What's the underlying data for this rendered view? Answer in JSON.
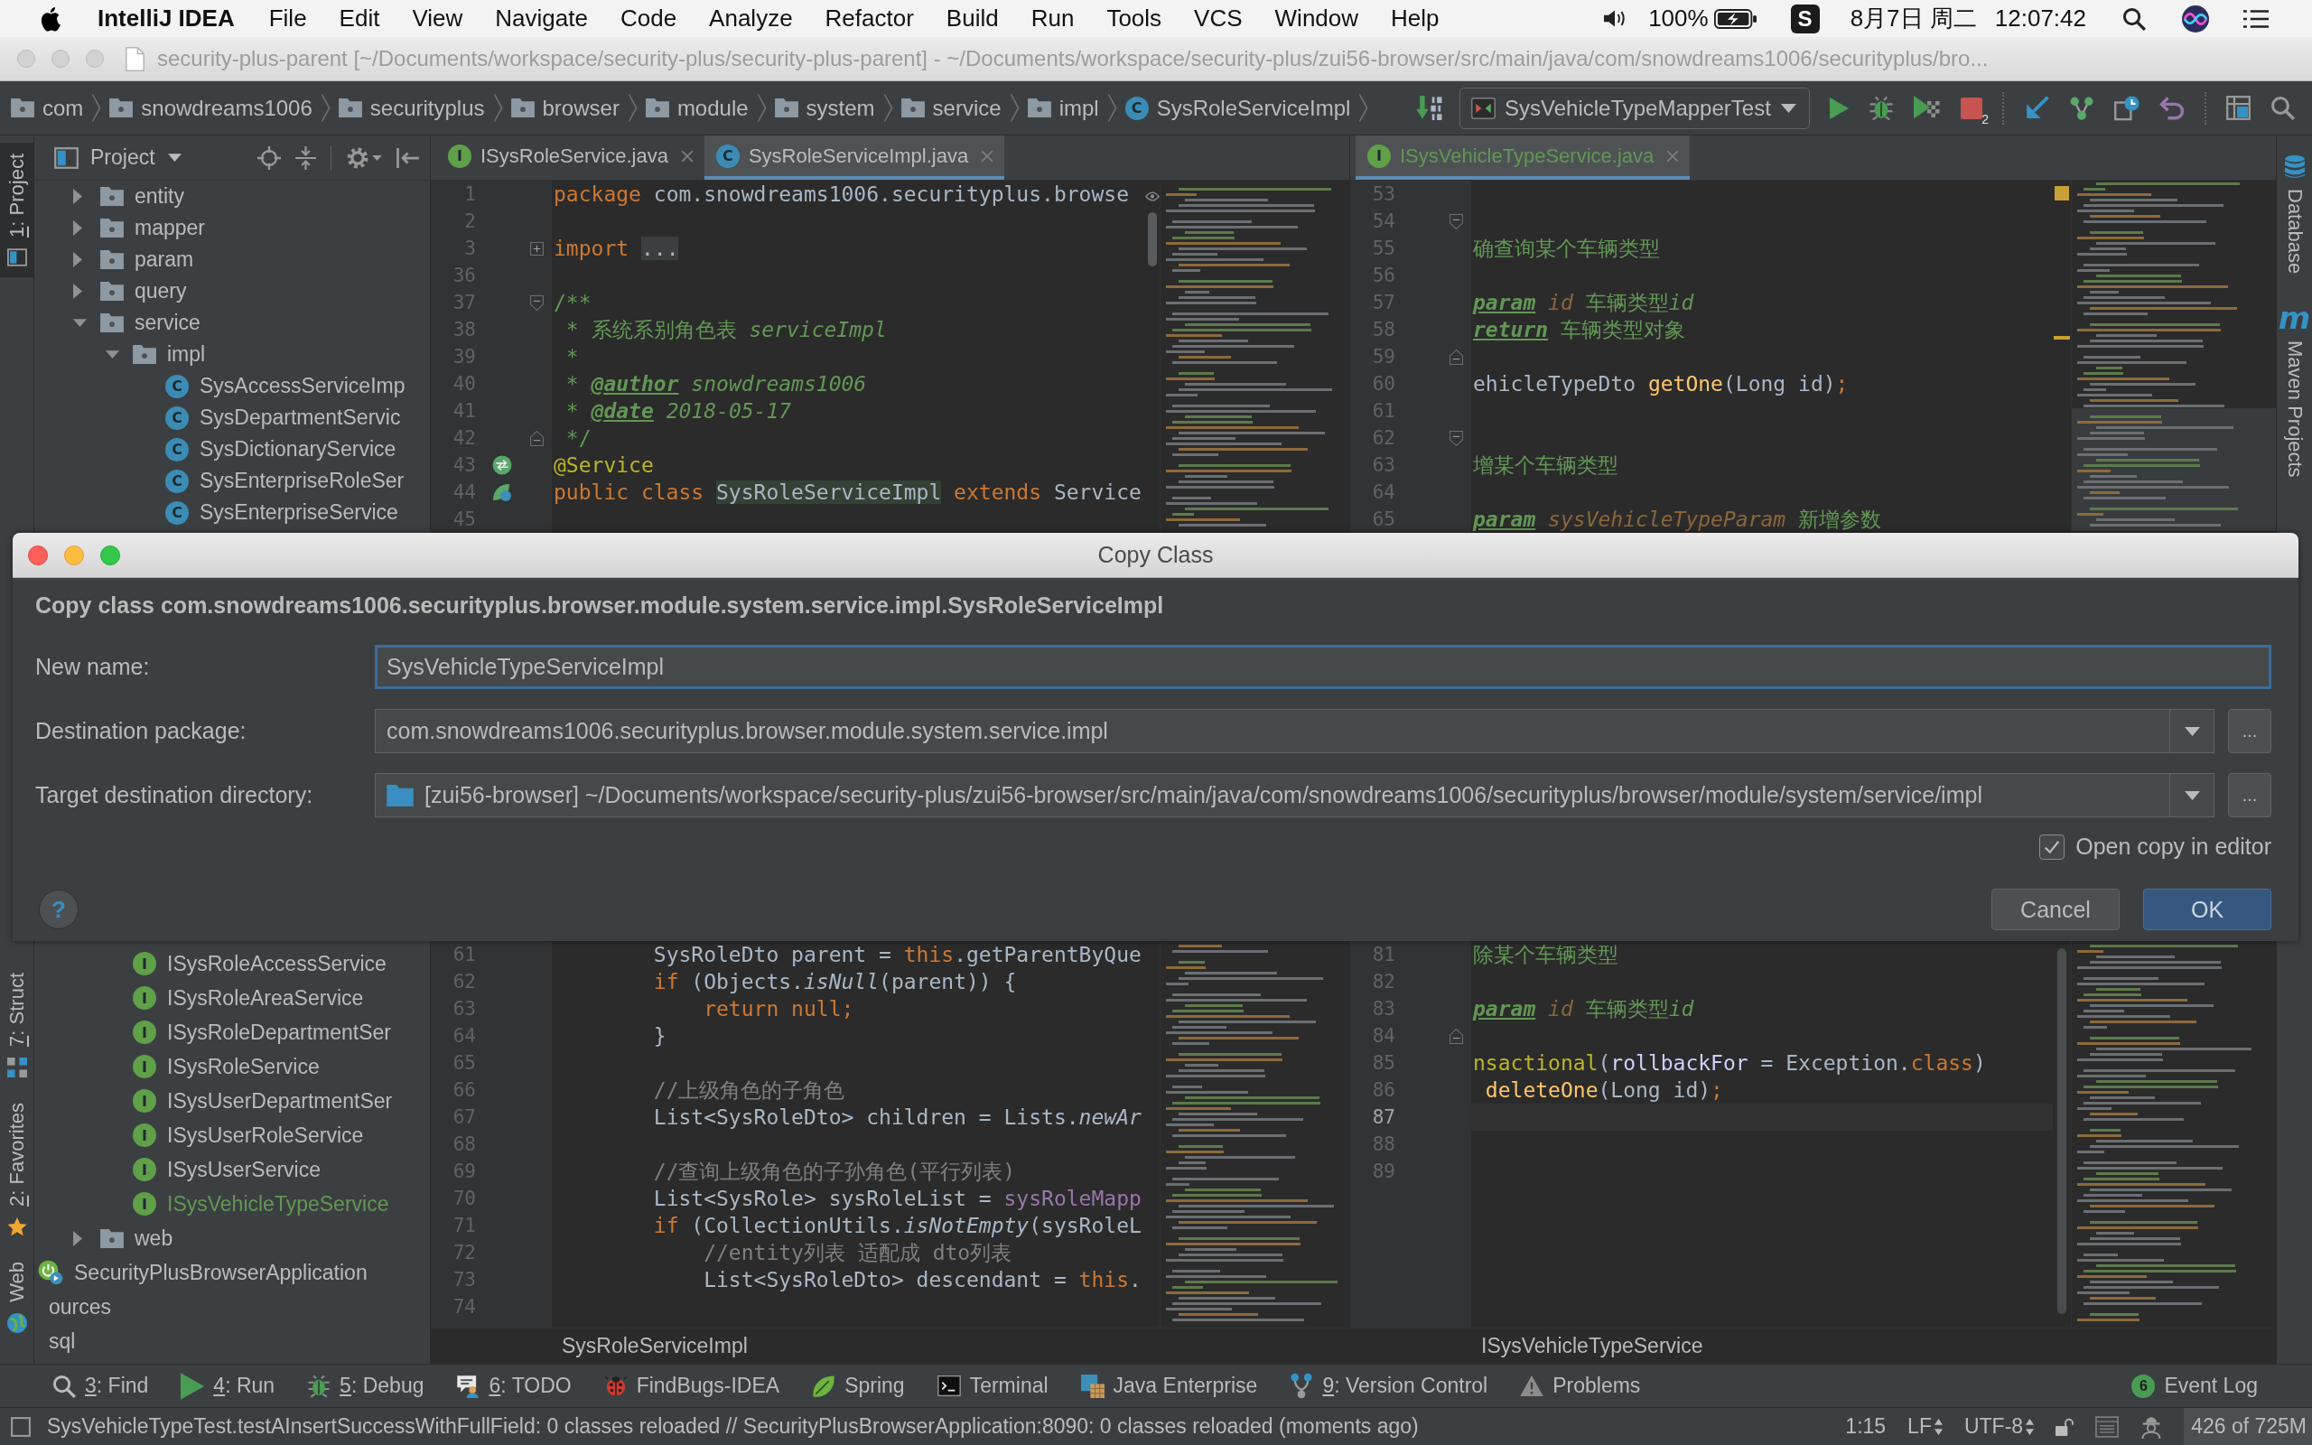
{
  "menu_bar": {
    "app_name": "IntelliJ IDEA",
    "menus": [
      "File",
      "Edit",
      "View",
      "Navigate",
      "Code",
      "Analyze",
      "Refactor",
      "Build",
      "Run",
      "Tools",
      "VCS",
      "Window",
      "Help"
    ],
    "battery": "100%",
    "input_method": "S",
    "date": "8月7日 周二",
    "time": "12:07:42"
  },
  "window": {
    "title": "security-plus-parent [~/Documents/workspace/security-plus/security-plus-parent] - ~/Documents/workspace/security-plus/zui56-browser/src/main/java/com/snowdreams1006/securityplus/bro..."
  },
  "navigation_bar": {
    "breadcrumbs": [
      {
        "kind": "package",
        "label": "com"
      },
      {
        "kind": "package",
        "label": "snowdreams1006"
      },
      {
        "kind": "package",
        "label": "securityplus"
      },
      {
        "kind": "package",
        "label": "browser"
      },
      {
        "kind": "package",
        "label": "module"
      },
      {
        "kind": "package",
        "label": "system"
      },
      {
        "kind": "package",
        "label": "service"
      },
      {
        "kind": "package",
        "label": "impl"
      },
      {
        "kind": "class",
        "label": "SysRoleServiceImpl",
        "icon_letter": "C"
      }
    ],
    "run_configuration": "SysVehicleTypeMapperTest",
    "stop_count": "2"
  },
  "left_stripe": [
    {
      "kind": "project",
      "label": "1: Project",
      "mnemonic": true,
      "selected": true
    },
    {
      "kind": "structure",
      "label": "7: Struct",
      "mnemonic": true,
      "selected": false
    },
    {
      "kind": "favorites",
      "label": "2: Favorites",
      "mnemonic": true,
      "selected": false
    },
    {
      "kind": "web",
      "label": "Web",
      "mnemonic": false,
      "selected": false
    }
  ],
  "project_panel": {
    "title": "Project",
    "tree": [
      {
        "kind": "package",
        "label": "entity",
        "expanded": false,
        "color": "#bbbbbb"
      },
      {
        "kind": "package",
        "label": "mapper",
        "expanded": false,
        "color": "#bbbbbb"
      },
      {
        "kind": "package",
        "label": "param",
        "expanded": false,
        "color": "#bbbbbb"
      },
      {
        "kind": "package",
        "label": "query",
        "expanded": false,
        "color": "#bbbbbb"
      },
      {
        "kind": "package",
        "label": "service",
        "expanded": true,
        "color": "#bbbbbb",
        "children": [
          {
            "kind": "package",
            "label": "impl",
            "expanded": true,
            "color": "#bbbbbb",
            "children": [
              {
                "kind": "class",
                "label": "SysAccessServiceImp",
                "icon_letter": "C",
                "color": "#bbbbbb"
              },
              {
                "kind": "class",
                "label": "SysDepartmentServic",
                "icon_letter": "C",
                "color": "#bbbbbb"
              },
              {
                "kind": "class",
                "label": "SysDictionaryService",
                "icon_letter": "C",
                "color": "#bbbbbb"
              },
              {
                "kind": "class",
                "label": "SysEnterpriseRoleSer",
                "icon_letter": "C",
                "color": "#bbbbbb"
              },
              {
                "kind": "class",
                "label": "SysEnterpriseService",
                "icon_letter": "C",
                "color": "#bbbbbb"
              }
            ]
          },
          {
            "kind": "interface",
            "label": "ISysRoleAccessService",
            "icon_letter": "I",
            "color": "#bbbbbb"
          },
          {
            "kind": "interface",
            "label": "ISysRoleAreaService",
            "icon_letter": "I",
            "color": "#bbbbbb"
          },
          {
            "kind": "interface",
            "label": "ISysRoleDepartmentSer",
            "icon_letter": "I",
            "color": "#bbbbbb"
          },
          {
            "kind": "interface",
            "label": "ISysRoleService",
            "icon_letter": "I",
            "color": "#bbbbbb"
          },
          {
            "kind": "interface",
            "label": "ISysUserDepartmentSer",
            "icon_letter": "I",
            "color": "#bbbbbb"
          },
          {
            "kind": "interface",
            "label": "ISysUserRoleService",
            "icon_letter": "I",
            "color": "#bbbbbb"
          },
          {
            "kind": "interface",
            "label": "ISysUserService",
            "icon_letter": "I",
            "color": "#bbbbbb"
          },
          {
            "kind": "interface",
            "label": "ISysVehicleTypeService",
            "icon_letter": "I",
            "color": "#629755"
          }
        ]
      },
      {
        "kind": "package",
        "label": "web",
        "expanded": false,
        "color": "#bbbbbb"
      },
      {
        "kind": "app",
        "label": "SecurityPlusBrowserApplication",
        "color": "#bbbbbb"
      },
      {
        "kind": "cut",
        "label": "ources",
        "color": "#bbbbbb"
      },
      {
        "kind": "cut",
        "label": "sql",
        "color": "#bbbbbb"
      }
    ]
  },
  "editors": [
    {
      "tabs": [
        {
          "kind": "interface",
          "icon_letter": "I",
          "label": "ISysRoleService.java",
          "selected": false,
          "color": "#bbbbbb"
        },
        {
          "kind": "class",
          "icon_letter": "C",
          "label": "SysRoleServiceImpl.java",
          "selected": true,
          "color": "#bbbbbb"
        }
      ],
      "lines_top": [
        {
          "kind": "code",
          "number": "1",
          "current": false,
          "segments": [
            {
              "kind": "kw",
              "text": "package"
            },
            {
              "kind": "plain",
              "text": " com.snowdreams1006.securityplus.browse"
            }
          ]
        },
        {
          "kind": "code",
          "number": "2",
          "current": false
        },
        {
          "kind": "folded",
          "number": "3",
          "current": false,
          "segments": [
            {
              "kind": "kw",
              "text": "import "
            },
            {
              "kind": "fold",
              "text": "..."
            }
          ]
        },
        {
          "kind": "code",
          "number": "36",
          "current": false
        },
        {
          "kind": "fold-start",
          "number": "37",
          "current": false,
          "segments": [
            {
              "kind": "doc",
              "text": "/**"
            }
          ]
        },
        {
          "kind": "code",
          "number": "38",
          "current": false,
          "segments": [
            {
              "kind": "doc",
              "text": " * 系统系别角色表 "
            },
            {
              "kind": "doc-i",
              "text": "serviceImpl"
            }
          ]
        },
        {
          "kind": "code",
          "number": "39",
          "current": false,
          "segments": [
            {
              "kind": "doc",
              "text": " *"
            }
          ]
        },
        {
          "kind": "code",
          "number": "40",
          "current": false,
          "segments": [
            {
              "kind": "doc",
              "text": " * "
            },
            {
              "kind": "tag",
              "text": "@author"
            },
            {
              "kind": "doc-i",
              "text": " snowdreams1006"
            }
          ]
        },
        {
          "kind": "code",
          "number": "41",
          "current": false,
          "segments": [
            {
              "kind": "doc",
              "text": " * "
            },
            {
              "kind": "tag",
              "text": "@date"
            },
            {
              "kind": "doc-i",
              "text": " 2018-05-17"
            }
          ]
        },
        {
          "kind": "fold-end",
          "number": "42",
          "current": false,
          "segments": [
            {
              "kind": "doc",
              "text": " */"
            }
          ]
        },
        {
          "kind": "bean",
          "number": "43",
          "current": false,
          "segments": [
            {
              "kind": "ann",
              "text": "@Service"
            }
          ]
        },
        {
          "kind": "bean-class",
          "number": "44",
          "current": false,
          "segments": [
            {
              "kind": "kw",
              "text": "public class "
            },
            {
              "kind": "hl",
              "text": "SysRoleServiceImpl"
            },
            {
              "kind": "kw",
              "text": " extends "
            },
            {
              "kind": "plain",
              "text": "Service"
            }
          ]
        },
        {
          "kind": "code",
          "number": "45",
          "current": false
        }
      ],
      "lines_bottom": [
        {
          "kind": "code",
          "number": "61",
          "current": false,
          "segments": [
            {
              "kind": "plain",
              "text": "        SysRoleDto parent = "
            },
            {
              "kind": "kw",
              "text": "this"
            },
            {
              "kind": "plain",
              "text": ".getParentByQue"
            }
          ]
        },
        {
          "kind": "code",
          "number": "62",
          "current": false,
          "segments": [
            {
              "kind": "kw",
              "text": "        if"
            },
            {
              "kind": "plain",
              "text": " (Objects."
            },
            {
              "kind": "static",
              "text": "isNull"
            },
            {
              "kind": "plain",
              "text": "(parent)) {"
            }
          ]
        },
        {
          "kind": "code",
          "number": "63",
          "current": false,
          "segments": [
            {
              "kind": "kw",
              "text": "            return null;"
            }
          ]
        },
        {
          "kind": "code",
          "number": "64",
          "current": false,
          "segments": [
            {
              "kind": "plain",
              "text": "        }"
            }
          ]
        },
        {
          "kind": "code",
          "number": "65",
          "current": false
        },
        {
          "kind": "code",
          "number": "66",
          "current": false,
          "segments": [
            {
              "kind": "cmt",
              "text": "        //上级角色的子角色"
            }
          ]
        },
        {
          "kind": "code",
          "number": "67",
          "current": false,
          "segments": [
            {
              "kind": "plain",
              "text": "        List<SysRoleDto> children = Lists."
            },
            {
              "kind": "static",
              "text": "newAr"
            }
          ]
        },
        {
          "kind": "code",
          "number": "68",
          "current": false
        },
        {
          "kind": "code",
          "number": "69",
          "current": false,
          "segments": [
            {
              "kind": "cmt",
              "text": "        //查询上级角色的子孙角色(平行列表)"
            }
          ]
        },
        {
          "kind": "code",
          "number": "70",
          "current": false,
          "segments": [
            {
              "kind": "plain",
              "text": "        List<SysRole> sysRoleList = "
            },
            {
              "kind": "field",
              "text": "sysRoleMapp"
            }
          ]
        },
        {
          "kind": "code",
          "number": "71",
          "current": false,
          "segments": [
            {
              "kind": "kw",
              "text": "        if"
            },
            {
              "kind": "plain",
              "text": " (CollectionUtils."
            },
            {
              "kind": "static",
              "text": "isNotEmpty"
            },
            {
              "kind": "plain",
              "text": "(sysRoleL"
            }
          ]
        },
        {
          "kind": "code",
          "number": "72",
          "current": false,
          "segments": [
            {
              "kind": "cmt",
              "text": "            //entity列表 适配成 dto列表"
            }
          ]
        },
        {
          "kind": "code",
          "number": "73",
          "current": false,
          "segments": [
            {
              "kind": "plain",
              "text": "            List<SysRoleDto> descendant = "
            },
            {
              "kind": "kw",
              "text": "this"
            },
            {
              "kind": "plain",
              "text": "."
            }
          ]
        },
        {
          "kind": "code",
          "number": "74",
          "current": false
        }
      ],
      "breadcrumb": "SysRoleServiceImpl"
    },
    {
      "tabs": [
        {
          "kind": "interface",
          "icon_letter": "I",
          "label": "ISysVehicleTypeService.java",
          "selected": true,
          "color": "#629755"
        }
      ],
      "lines_top": [
        {
          "kind": "code",
          "number": "53",
          "current": false
        },
        {
          "kind": "fold-start",
          "number": "54",
          "current": false
        },
        {
          "kind": "code",
          "number": "55",
          "current": false,
          "segments": [
            {
              "kind": "doc",
              "text": "确查询某个车辆类型"
            }
          ]
        },
        {
          "kind": "code",
          "number": "56",
          "current": false
        },
        {
          "kind": "code",
          "number": "57",
          "current": false,
          "segments": [
            {
              "kind": "tag",
              "text": "param"
            },
            {
              "kind": "param",
              "text": " id"
            },
            {
              "kind": "doc",
              "text": " 车辆类型"
            },
            {
              "kind": "doc-i",
              "text": "id"
            }
          ]
        },
        {
          "kind": "code",
          "number": "58",
          "current": false,
          "segments": [
            {
              "kind": "tag",
              "text": "return"
            },
            {
              "kind": "doc",
              "text": " 车辆类型对象"
            }
          ]
        },
        {
          "kind": "fold-end",
          "number": "59",
          "current": false
        },
        {
          "kind": "code",
          "number": "60",
          "current": false,
          "segments": [
            {
              "kind": "plain",
              "text": "ehicleTypeDto "
            },
            {
              "kind": "method",
              "text": "getOne"
            },
            {
              "kind": "plain",
              "text": "(Long id)"
            },
            {
              "kind": "kw",
              "text": ";"
            }
          ]
        },
        {
          "kind": "code",
          "number": "61",
          "current": false
        },
        {
          "kind": "fold-start",
          "number": "62",
          "current": false
        },
        {
          "kind": "code",
          "number": "63",
          "current": false,
          "segments": [
            {
              "kind": "doc",
              "text": "增某个车辆类型"
            }
          ]
        },
        {
          "kind": "code",
          "number": "64",
          "current": false
        },
        {
          "kind": "code",
          "number": "65",
          "current": false,
          "segments": [
            {
              "kind": "tag",
              "text": "param"
            },
            {
              "kind": "param",
              "text": " sysVehicleTypeParam"
            },
            {
              "kind": "doc",
              "text": " 新增参数"
            }
          ]
        }
      ],
      "lines_bottom": [
        {
          "kind": "code",
          "number": "81",
          "current": false,
          "segments": [
            {
              "kind": "doc",
              "text": "除某个车辆类型"
            }
          ]
        },
        {
          "kind": "code",
          "number": "82",
          "current": false
        },
        {
          "kind": "code",
          "number": "83",
          "current": false,
          "segments": [
            {
              "kind": "tag",
              "text": "param"
            },
            {
              "kind": "param",
              "text": " id"
            },
            {
              "kind": "doc",
              "text": " 车辆类型"
            },
            {
              "kind": "doc-i",
              "text": "id"
            }
          ]
        },
        {
          "kind": "fold-end",
          "number": "84",
          "current": false
        },
        {
          "kind": "code",
          "number": "85",
          "current": false,
          "segments": [
            {
              "kind": "ann",
              "text": "nsactional"
            },
            {
              "kind": "plain",
              "text": "("
            },
            {
              "kind": "attr",
              "text": "rollbackFor"
            },
            {
              "kind": "plain",
              "text": " = Exception."
            },
            {
              "kind": "kw",
              "text": "class"
            },
            {
              "kind": "plain",
              "text": ")"
            }
          ]
        },
        {
          "kind": "code",
          "number": "86",
          "current": false,
          "segments": [
            {
              "kind": "method",
              "text": " deleteOne"
            },
            {
              "kind": "plain",
              "text": "(Long id)"
            },
            {
              "kind": "kw",
              "text": ";"
            }
          ]
        },
        {
          "kind": "code",
          "number": "87",
          "current": true
        },
        {
          "kind": "code",
          "number": "88",
          "current": false
        },
        {
          "kind": "code",
          "number": "89",
          "current": false
        }
      ],
      "breadcrumb": "ISysVehicleTypeService"
    }
  ],
  "right_stripe": [
    {
      "kind": "database",
      "label": "Database"
    },
    {
      "kind": "maven",
      "label": "Maven Projects",
      "icon_letter": "m"
    }
  ],
  "dialog": {
    "title": "Copy Class",
    "heading": "Copy class com.snowdreams1006.securityplus.browser.module.system.service.impl.SysRoleServiceImpl",
    "fields": [
      {
        "kind": "text",
        "label": "New name:",
        "value": "SysVehicleTypeServiceImpl",
        "focused": true
      },
      {
        "kind": "combo",
        "label": "Destination package:",
        "value": "com.snowdreams1006.securityplus.browser.module.system.service.impl",
        "browse": "...",
        "focused": false
      },
      {
        "kind": "directory",
        "label": "Target destination directory:",
        "value": "[zui56-browser] ~/Documents/workspace/security-plus/zui56-browser/src/main/java/com/snowdreams1006/securityplus/browser/module/system/service/impl",
        "browse": "...",
        "focused": false
      }
    ],
    "checkbox": {
      "label": "Open copy in editor",
      "checked": true
    },
    "help": "?",
    "buttons": [
      {
        "label": "Cancel",
        "default": false
      },
      {
        "label": "OK",
        "default": true
      }
    ]
  },
  "tool_windows": [
    {
      "kind": "find",
      "label": "3: Find",
      "mnemonic": true
    },
    {
      "kind": "run",
      "label": "4: Run",
      "mnemonic": true
    },
    {
      "kind": "debug",
      "label": "5: Debug",
      "mnemonic": true
    },
    {
      "kind": "todo",
      "label": "6: TODO",
      "mnemonic": true
    },
    {
      "kind": "findbugs",
      "label": "FindBugs-IDEA",
      "mnemonic": false
    },
    {
      "kind": "spring",
      "label": "Spring",
      "mnemonic": false
    },
    {
      "kind": "terminal",
      "label": "Terminal",
      "mnemonic": false
    },
    {
      "kind": "javaee",
      "label": "Java Enterprise",
      "mnemonic": false
    },
    {
      "kind": "vcs",
      "label": "9: Version Control",
      "mnemonic": true
    },
    {
      "kind": "problems",
      "label": "Problems",
      "mnemonic": false
    }
  ],
  "event_log": {
    "label": "Event Log",
    "count": "6"
  },
  "status_bar": {
    "message": "SysVehicleTypeTest.testAInsertSuccessWithFullField: 0 classes reloaded // SecurityPlusBrowserApplication:8090: 0 classes reloaded (moments ago)",
    "position": "1:15",
    "line_separator": "LF",
    "encoding": "UTF-8",
    "memory": "426 of 725M"
  }
}
